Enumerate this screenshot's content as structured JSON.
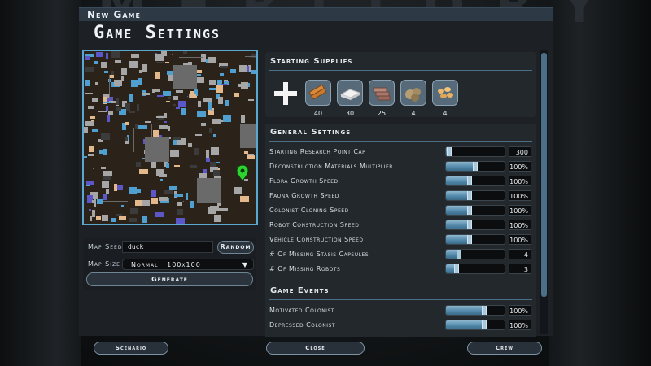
{
  "background_word": "MERITORY",
  "header": {
    "top_title": "New Game",
    "page_title": "Game Settings"
  },
  "map": {
    "marker_icon": "map-pin-icon",
    "colors": {
      "ground": "#2b231a",
      "water": "#4f9fd0",
      "rock": "#a6a6a6",
      "sand": "#e3b88a",
      "violet": "#5b57c8",
      "marker": "#2ed32e"
    }
  },
  "seed": {
    "label": "Map Seed",
    "value": "duck",
    "random_label": "Random",
    "size_label": "Map Size",
    "size_value": "Normal   100x100",
    "generate_label": "Generate"
  },
  "supplies": {
    "title": "Starting Supplies",
    "add_icon": "plus-icon",
    "items": [
      {
        "icon": "wood-planks-icon",
        "count": "40"
      },
      {
        "icon": "stone-block-icon",
        "count": "30"
      },
      {
        "icon": "metal-bars-icon",
        "count": "25"
      },
      {
        "icon": "rocks-icon",
        "count": "4"
      },
      {
        "icon": "food-icon",
        "count": "4"
      }
    ]
  },
  "general": {
    "title": "General Settings",
    "rows": [
      {
        "label": "Starting Research Point Cap",
        "value": "300",
        "level": 0.05
      },
      {
        "label": "Deconstruction Materials Multiplier",
        "value": "100%",
        "level": 0.5
      },
      {
        "label": "Flora Growth Speed",
        "value": "100%",
        "level": 0.4
      },
      {
        "label": "Fauna Growth Speed",
        "value": "100%",
        "level": 0.4
      },
      {
        "label": "Colonist Cloning Speed",
        "value": "100%",
        "level": 0.4
      },
      {
        "label": "Robot Construction Speed",
        "value": "100%",
        "level": 0.4
      },
      {
        "label": "Vehicle Construction Speed",
        "value": "100%",
        "level": 0.4
      },
      {
        "label": "# Of Missing Stasis Capsules",
        "value": "4",
        "level": 0.22
      },
      {
        "label": "# Of Missing Robots",
        "value": "3",
        "level": 0.18
      }
    ]
  },
  "events": {
    "title": "Game Events",
    "rows": [
      {
        "label": "Motivated Colonist",
        "value": "100%",
        "level": 0.65
      },
      {
        "label": "Depressed Colonist",
        "value": "100%",
        "level": 0.65
      }
    ]
  },
  "footer": {
    "scenario_label": "Scenario",
    "close_label": "Close",
    "crew_label": "Crew"
  }
}
